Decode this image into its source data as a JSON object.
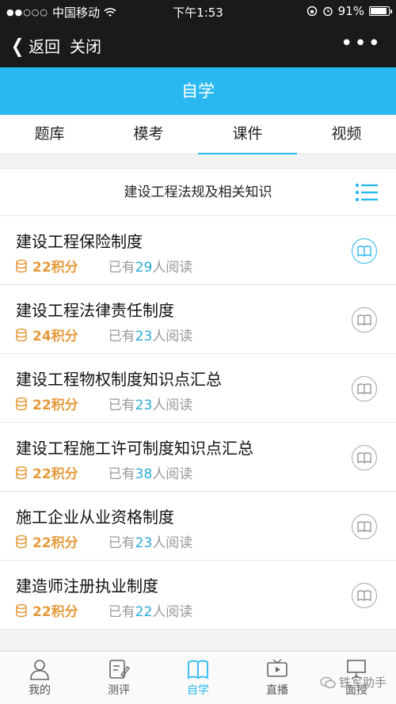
{
  "status": {
    "carrier": "中国移动",
    "time": "下午1:53",
    "battery": "91%",
    "battery_level": 0.91
  },
  "nav": {
    "back_label": "返回",
    "close_label": "关闭",
    "more_label": "•••"
  },
  "page_title": "自学",
  "tabs": [
    {
      "label": "题库"
    },
    {
      "label": "模考"
    },
    {
      "label": "课件",
      "active": true
    },
    {
      "label": "视频"
    }
  ],
  "section": {
    "title": "建设工程法规及相关知识"
  },
  "items": [
    {
      "title": "建设工程保险制度",
      "points": "22积分",
      "read_prefix": "已有",
      "read_count": "29",
      "read_suffix": "人阅读"
    },
    {
      "title": "建设工程法律责任制度",
      "points": "24积分",
      "read_prefix": "已有",
      "read_count": "23",
      "read_suffix": "人阅读"
    },
    {
      "title": "建设工程物权制度知识点汇总",
      "points": "22积分",
      "read_prefix": "已有",
      "read_count": "23",
      "read_suffix": "人阅读"
    },
    {
      "title": "建设工程施工许可制度知识点汇总",
      "points": "22积分",
      "read_prefix": "已有",
      "read_count": "38",
      "read_suffix": "人阅读"
    },
    {
      "title": "施工企业从业资格制度",
      "points": "22积分",
      "read_prefix": "已有",
      "read_count": "23",
      "read_suffix": "人阅读"
    },
    {
      "title": "建造师注册执业制度",
      "points": "22积分",
      "read_prefix": "已有",
      "read_count": "22",
      "read_suffix": "人阅读"
    }
  ],
  "bottom_nav": [
    {
      "label": "我的",
      "icon": "person-icon"
    },
    {
      "label": "测评",
      "icon": "edit-icon"
    },
    {
      "label": "自学",
      "icon": "book-icon",
      "active": true
    },
    {
      "label": "直播",
      "icon": "tv-icon"
    },
    {
      "label": "面授",
      "icon": "presentation-icon"
    }
  ],
  "watermark": "铁军助手",
  "colors": {
    "accent": "#29b8f0",
    "points": "#e59a3a",
    "dark_bar": "#1a1a1a"
  }
}
